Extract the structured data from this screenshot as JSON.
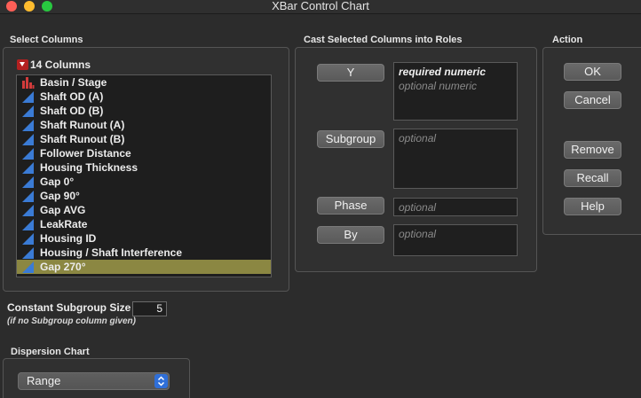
{
  "window": {
    "title": "XBar Control Chart"
  },
  "select_columns": {
    "label": "Select Columns",
    "count_label": "14 Columns",
    "items": [
      {
        "label": "Basin / Stage",
        "icon": "nominal-bar-icon",
        "selected": false
      },
      {
        "label": "Shaft OD (A)",
        "icon": "continuous-icon",
        "selected": false
      },
      {
        "label": "Shaft OD (B)",
        "icon": "continuous-icon",
        "selected": false
      },
      {
        "label": "Shaft Runout (A)",
        "icon": "continuous-icon",
        "selected": false
      },
      {
        "label": "Shaft Runout (B)",
        "icon": "continuous-icon",
        "selected": false
      },
      {
        "label": "Follower Distance",
        "icon": "continuous-icon",
        "selected": false
      },
      {
        "label": "Housing Thickness",
        "icon": "continuous-icon",
        "selected": false
      },
      {
        "label": "Gap 0°",
        "icon": "continuous-icon",
        "selected": false
      },
      {
        "label": "Gap 90°",
        "icon": "continuous-icon",
        "selected": false
      },
      {
        "label": "Gap AVG",
        "icon": "continuous-icon",
        "selected": false
      },
      {
        "label": "LeakRate",
        "icon": "continuous-icon",
        "selected": false
      },
      {
        "label": "Housing ID",
        "icon": "continuous-icon",
        "selected": false
      },
      {
        "label": "Housing / Shaft Interference",
        "icon": "continuous-icon",
        "selected": false
      },
      {
        "label": "Gap 270°",
        "icon": "continuous-icon",
        "selected": true
      }
    ]
  },
  "roles": {
    "label": "Cast Selected Columns into Roles",
    "y": {
      "button": "Y",
      "line1": "required numeric",
      "line2": "optional numeric"
    },
    "subgroup": {
      "button": "Subgroup",
      "placeholder": "optional"
    },
    "phase": {
      "button": "Phase",
      "placeholder": "optional"
    },
    "by": {
      "button": "By",
      "placeholder": "optional"
    }
  },
  "action": {
    "label": "Action",
    "ok": "OK",
    "cancel": "Cancel",
    "remove": "Remove",
    "recall": "Recall",
    "help": "Help"
  },
  "subgroup_size": {
    "label": "Constant Subgroup Size",
    "value": "5",
    "note": "(if no Subgroup column given)"
  },
  "dispersion": {
    "label": "Dispersion Chart",
    "selected": "Range"
  },
  "colors": {
    "selection": "#8b8742",
    "continuous_icon": "#3a7bd5",
    "nominal_icon": "#d23b3b"
  }
}
